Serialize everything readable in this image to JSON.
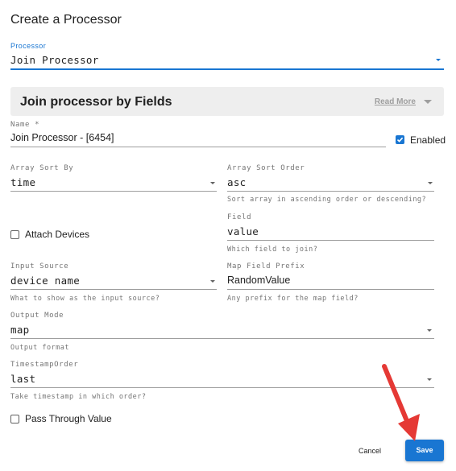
{
  "dialog": {
    "title": "Create a Processor"
  },
  "processor": {
    "label": "Processor",
    "value": "Join Processor"
  },
  "section": {
    "title": "Join processor by Fields",
    "read_more": "Read More"
  },
  "name": {
    "label": "Name *",
    "value": "Join Processor  - [6454]"
  },
  "enabled": {
    "label": "Enabled",
    "checked": true
  },
  "array_sort_by": {
    "label": "Array Sort By",
    "value": "time"
  },
  "array_sort_order": {
    "label": "Array Sort Order",
    "value": "asc",
    "helper": "Sort array in ascending order or descending?"
  },
  "attach_devices": {
    "label": "Attach Devices",
    "checked": false
  },
  "field": {
    "label": "Field",
    "value": "value",
    "helper": "Which field to join?"
  },
  "input_source": {
    "label": "Input Source",
    "value": "device name",
    "helper": "What to show as the input source?"
  },
  "map_field_prefix": {
    "label": "Map Field Prefix",
    "value": "RandomValue",
    "helper": "Any prefix for the map field?"
  },
  "output_mode": {
    "label": "Output Mode",
    "value": "map",
    "helper": "Output format"
  },
  "timestamp_order": {
    "label": "TimestampOrder",
    "value": "last",
    "helper": "Take timestamp in which order?"
  },
  "pass_through": {
    "label": "Pass Through Value",
    "checked": false
  },
  "actions": {
    "cancel": "Cancel",
    "save": "Save"
  },
  "colors": {
    "accent": "#1976d2",
    "annotation_arrow": "#e53935"
  }
}
